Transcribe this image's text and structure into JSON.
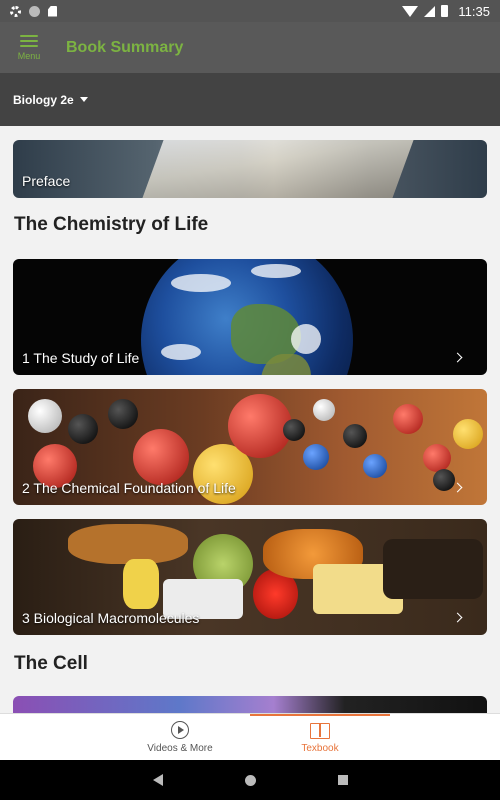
{
  "status_bar": {
    "time": "11:35",
    "icons": [
      "settings-icon",
      "circle-icon",
      "sd-card-icon",
      "wifi-icon",
      "signal-icon",
      "battery-icon"
    ]
  },
  "app_bar": {
    "menu_label": "Menu",
    "title": "Book Summary",
    "accent_color": "#7cb342"
  },
  "sub_bar": {
    "selected_book": "Biology 2e"
  },
  "content": {
    "preface": {
      "label": "Preface"
    },
    "sections": [
      {
        "title": "The Chemistry of Life",
        "chapters": [
          {
            "label": "1 The Study of Life"
          },
          {
            "label": "2 The Chemical Foundation of Life"
          },
          {
            "label": "3 Biological Macromolecules"
          }
        ]
      },
      {
        "title": "The Cell",
        "chapters": []
      }
    ]
  },
  "bottom_nav": {
    "items": [
      {
        "label": "Videos & More",
        "icon": "play-circle-icon",
        "active": false
      },
      {
        "label": "Texbook",
        "icon": "book-open-icon",
        "active": true
      }
    ],
    "active_color": "#e8743b"
  },
  "android_nav": {
    "icons": [
      "back-icon",
      "home-icon",
      "recents-icon"
    ]
  }
}
